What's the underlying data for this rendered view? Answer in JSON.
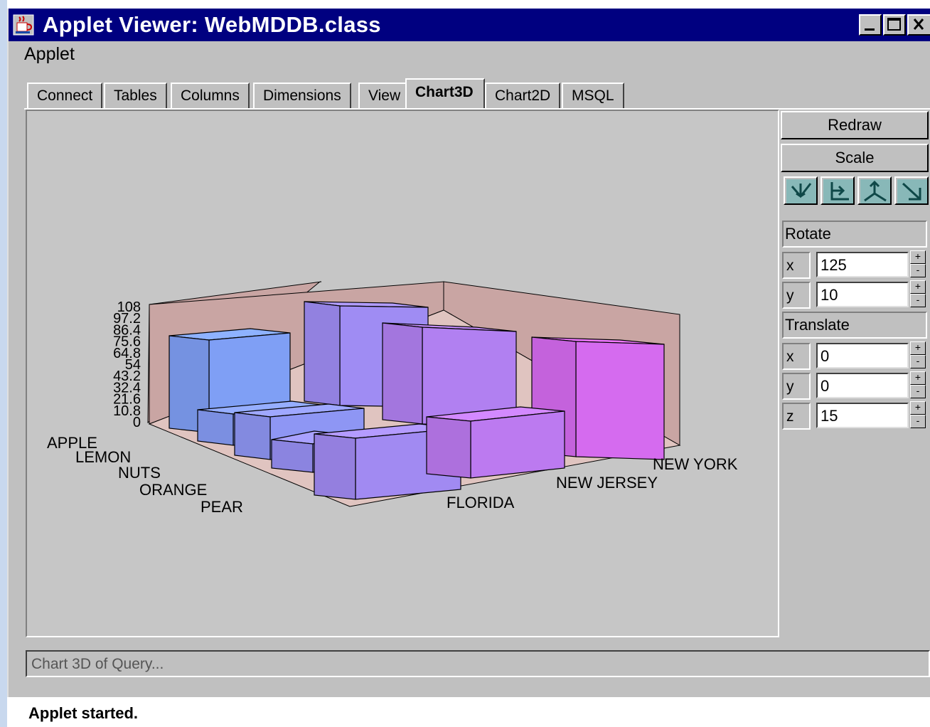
{
  "window": {
    "title": "Applet Viewer: WebMDDB.class",
    "menu": "Applet"
  },
  "tabs": [
    "Connect",
    "Tables",
    "Columns",
    "Dimensions",
    "View",
    "Chart3D",
    "Chart2D",
    "MSQL"
  ],
  "active_tab": "Chart3D",
  "controls": {
    "redraw_label": "Redraw",
    "scale_label": "Scale",
    "view_buttons": [
      "view-down-icon",
      "view-side-icon",
      "view-axes-icon",
      "view-diagonal-icon"
    ],
    "rotate_label": "Rotate",
    "rotate_x_label": "x",
    "rotate_x_value": "125",
    "rotate_y_label": "y",
    "rotate_y_value": "10",
    "translate_label": "Translate",
    "translate_x_label": "x",
    "translate_x_value": "0",
    "translate_y_label": "y",
    "translate_y_value": "0",
    "translate_z_label": "z",
    "translate_z_value": "15",
    "spin_plus": "+",
    "spin_minus": "-"
  },
  "status_field_text": "Chart 3D of Query...",
  "status_bar_text": "Applet started.",
  "chart_data": {
    "type": "bar",
    "z_ticks": [
      "108",
      "97.2",
      "86.4",
      "75.6",
      "64.8",
      "54",
      "43.2",
      "32.4",
      "21.6",
      "10.8",
      "0"
    ],
    "products": [
      "APPLE",
      "LEMON",
      "NUTS",
      "ORANGE",
      "PEAR"
    ],
    "states": [
      "FLORIDA",
      "NEW JERSEY",
      "NEW YORK"
    ],
    "ylim": [
      0,
      108
    ],
    "colors": {
      "floor": "#e0c4c0",
      "back_wall": "#c9a5a3",
      "bar_start": "#7f9ff5",
      "bar_end": "#dd66ee"
    }
  }
}
